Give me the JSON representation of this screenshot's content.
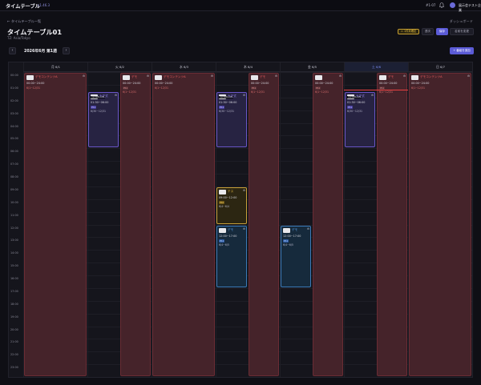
{
  "app": {
    "title": "タイムテーブル",
    "version": "v1.46.3"
  },
  "header": {
    "id": "#1-07",
    "company": "展示会テスト企業"
  },
  "page": {
    "back_link": "← タイムテーブル一覧",
    "title": "タイムテーブル01",
    "timezone": "TZ: Asia/Tokyo",
    "dashboard_link": "ダッシュボード"
  },
  "toolbar": {
    "warning_badge": "⚠ 1件未確定",
    "btn_view": "週次",
    "btn_active": "保存",
    "btn_settings": "名前を変更"
  },
  "week": {
    "prev": "‹",
    "next": "›",
    "label": "2026年6月 第1週",
    "add_label": "+ 番組を追加"
  },
  "days": [
    {
      "label": "月 6/1",
      "today": false
    },
    {
      "label": "火 6/2",
      "today": false
    },
    {
      "label": "水 6/3",
      "today": false
    },
    {
      "label": "木 6/4",
      "today": false
    },
    {
      "label": "金 6/5",
      "today": false
    },
    {
      "label": "土 6/6",
      "today": true
    },
    {
      "label": "日 6/7",
      "today": false
    }
  ],
  "times": [
    "00:00",
    "01:00",
    "02:00",
    "03:00",
    "04:00",
    "05:00",
    "06:00",
    "07:00",
    "08:00",
    "09:00",
    "10:00",
    "11:00",
    "12:00",
    "13:00",
    "14:00",
    "15:00",
    "16:00",
    "17:00",
    "18:00",
    "19:00",
    "20:00",
    "21:00",
    "22:00",
    "23:00"
  ],
  "events": [
    {
      "day": 0,
      "sub": 0,
      "subs": 1,
      "start": 0,
      "end": 24,
      "color": "red",
      "title": "デモコンテンツA",
      "time": "00:00~24:00",
      "tag": "",
      "range": "6/1~12/31",
      "id": ""
    },
    {
      "day": 1,
      "sub": 0,
      "subs": 2,
      "start": 1.5,
      "end": 6,
      "color": "purple",
      "title": "大正式",
      "time": "01:30~06:00",
      "tag": "PS1",
      "range": "6/30~12/31",
      "id": "01EMB1-LP5"
    },
    {
      "day": 1,
      "sub": 1,
      "subs": 2,
      "start": 0,
      "end": 24,
      "color": "red",
      "title": "デモ",
      "time": "00:00~24:00",
      "tag": "PS1",
      "range": "6/1~12/31",
      "id": ""
    },
    {
      "day": 2,
      "sub": 0,
      "subs": 1,
      "start": 0,
      "end": 24,
      "color": "red",
      "title": "デモコンテンツA",
      "time": "00:00~24:00",
      "tag": "",
      "range": "6/1~12/31",
      "id": ""
    },
    {
      "day": 3,
      "sub": 0,
      "subs": 2,
      "start": 1.5,
      "end": 6,
      "color": "purple",
      "title": "大正式",
      "time": "01:30~06:00",
      "tag": "PS1",
      "range": "6/30~12/31",
      "id": "01EMB1-LP5"
    },
    {
      "day": 3,
      "sub": 0,
      "subs": 2,
      "start": 9,
      "end": 12,
      "color": "gold",
      "title": "テス",
      "time": "09:00~12:00",
      "tag": "PS0",
      "range": "6/4~6/4",
      "id": ""
    },
    {
      "day": 3,
      "sub": 0,
      "subs": 2,
      "start": 12,
      "end": 17,
      "color": "blue",
      "title": "デモ",
      "time": "12:00~17:00",
      "tag": "PS1",
      "range": "6/4~6/5",
      "id": ""
    },
    {
      "day": 3,
      "sub": 1,
      "subs": 2,
      "start": 0,
      "end": 24,
      "color": "red",
      "title": "デモ",
      "time": "00:00~24:00",
      "tag": "PS1",
      "range": "6/1~12/31",
      "id": ""
    },
    {
      "day": 4,
      "sub": 0,
      "subs": 2,
      "start": 12,
      "end": 17,
      "color": "blue",
      "title": "デモ",
      "time": "12:00~17:00",
      "tag": "PS1",
      "range": "6/4~6/5",
      "id": ""
    },
    {
      "day": 4,
      "sub": 1,
      "subs": 2,
      "start": 0,
      "end": 24,
      "color": "red",
      "title": "",
      "time": "00:00~24:00",
      "tag": "PS1",
      "range": "6/1~12/31",
      "id": ""
    },
    {
      "day": 5,
      "sub": 0,
      "subs": 2,
      "start": 1.5,
      "end": 6,
      "color": "purple",
      "title": "大正式",
      "time": "01:30~06:00",
      "tag": "PS1",
      "range": "6/30~12/31",
      "id": "01EMB1-LP5"
    },
    {
      "day": 5,
      "sub": 1,
      "subs": 2,
      "start": 0,
      "end": 24,
      "color": "red",
      "title": "デモ",
      "time": "00:00~24:00",
      "tag": "PS1",
      "range": "6/1~12/31",
      "id": ""
    },
    {
      "day": 6,
      "sub": 0,
      "subs": 1,
      "start": 0,
      "end": 24,
      "color": "red",
      "title": "デモコンテンツA",
      "time": "00:00~24:00",
      "tag": "",
      "range": "6/1~12/31",
      "id": ""
    }
  ],
  "now_marker": {
    "day": 5,
    "hour": 1.4
  }
}
